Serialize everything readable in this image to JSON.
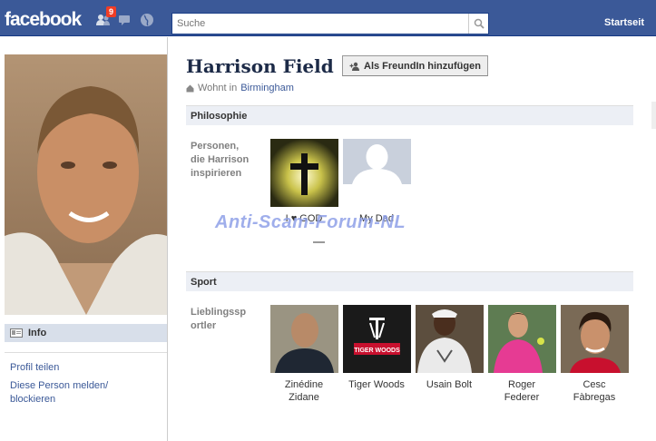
{
  "topbar": {
    "logo": "facebook",
    "notification_count": "9",
    "search_placeholder": "Suche",
    "home_label": "Startseit"
  },
  "profile": {
    "name": "Harrison Field",
    "add_friend_label": "Als FreundIn hinzufügen",
    "lives_prefix": "Wohnt in",
    "lives_city": "Birmingham"
  },
  "left": {
    "info_label": "Info",
    "share_link": "Profil teilen",
    "report_link_1": "Diese Person melden/",
    "report_link_2": "blockieren"
  },
  "philosophy": {
    "title": "Philosophie",
    "label_1": "Personen,",
    "label_2": "die Harrison",
    "label_3": "inspirieren",
    "items": [
      {
        "caption": "I ♥ GOD"
      },
      {
        "caption": "My Dad"
      }
    ]
  },
  "sport": {
    "title": "Sport",
    "label_1": "Lieblingssp",
    "label_2": "ortler",
    "items": [
      {
        "caption_1": "Zinédine",
        "caption_2": "Zidane"
      },
      {
        "caption_1": "Tiger Woods",
        "caption_2": ""
      },
      {
        "caption_1": "Usain Bolt",
        "caption_2": ""
      },
      {
        "caption_1": "Roger",
        "caption_2": "Federer"
      },
      {
        "caption_1": "Cesc",
        "caption_2": "Fàbregas"
      }
    ]
  },
  "watermark": "Anti-Scam-Forum-NL",
  "tiger_logo_text": "TIGER WOODS"
}
